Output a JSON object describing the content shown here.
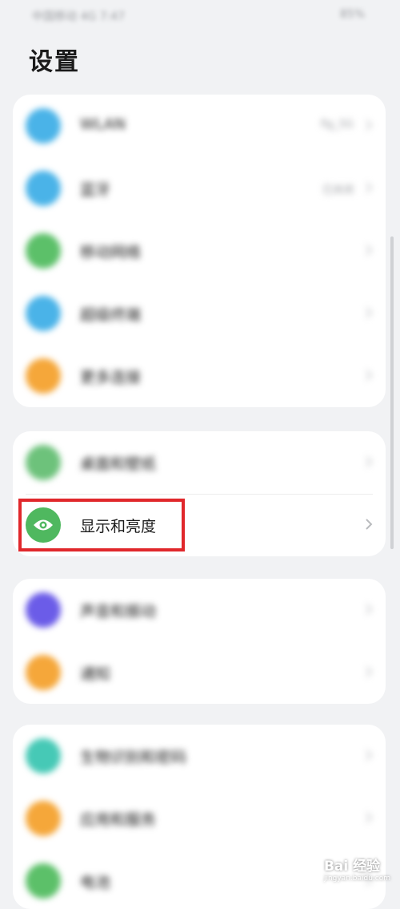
{
  "status_bar": {
    "left": "中国移动 4G 7:47",
    "right": "85%"
  },
  "title": "设置",
  "groups": [
    {
      "rows": [
        {
          "label": "WLAN",
          "value": "flg_5G",
          "color": "#4ab3e8",
          "icon": "wifi-icon"
        },
        {
          "label": "蓝牙",
          "value": "已关闭",
          "color": "#4ab3e8",
          "icon": "bluetooth-icon"
        },
        {
          "label": "移动网络",
          "value": "",
          "color": "#5cc069",
          "icon": "mobile-network-icon"
        },
        {
          "label": "超级终端",
          "value": "",
          "color": "#4ab3e8",
          "icon": "super-device-icon"
        },
        {
          "label": "更多连接",
          "value": "",
          "color": "#f5a73a",
          "icon": "link-icon"
        }
      ]
    },
    {
      "rows": [
        {
          "label": "桌面和壁纸",
          "value": "",
          "color": "#6dc27b",
          "icon": "wallpaper-icon"
        },
        {
          "label": "显示和亮度",
          "value": "",
          "color": "#4fb85f",
          "icon": "eye-icon"
        }
      ]
    },
    {
      "rows": [
        {
          "label": "声音和振动",
          "value": "",
          "color": "#6b5ce8",
          "icon": "sound-icon"
        },
        {
          "label": "通知",
          "value": "",
          "color": "#f5a73a",
          "icon": "bell-icon"
        }
      ]
    },
    {
      "rows": [
        {
          "label": "生物识别和密码",
          "value": "",
          "color": "#46c9b6",
          "icon": "key-icon"
        },
        {
          "label": "应用和服务",
          "value": "",
          "color": "#f5a73a",
          "icon": "apps-icon"
        },
        {
          "label": "电池",
          "value": "",
          "color": "#5cc069",
          "icon": "battery-icon"
        }
      ]
    }
  ],
  "watermark": {
    "main": "Bai 经验",
    "sub": "jingyan.baidu.com"
  }
}
